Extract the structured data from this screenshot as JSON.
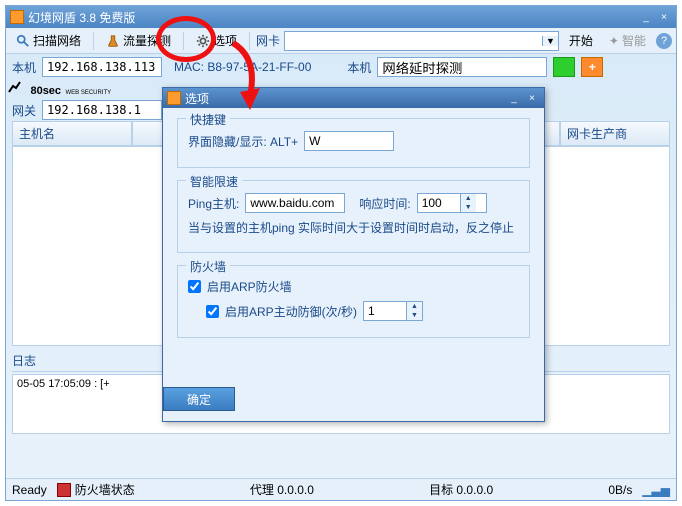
{
  "main": {
    "title": "幻境网盾 3.8 免费版",
    "toolbar": {
      "scan": "扫描网络",
      "traffic": "流量探测",
      "options": "选项",
      "netcard": "网卡",
      "start": "开始",
      "smart": "智能"
    },
    "row2": {
      "host_label": "本机",
      "host_ip": "192.168.138.113",
      "mac_label": "MAC: B8-97-5A-21-FF-00",
      "host2_label": "本机",
      "probe_value": "网络延时探测"
    },
    "row3": {
      "gateway_label": "网关",
      "gateway_ip": "192.168.138.1"
    },
    "logo": {
      "brand": "80sec",
      "sub": "WEB SECURITY"
    },
    "columns": {
      "hostname": "主机名",
      "vendor": "网卡生产商"
    },
    "log": {
      "title": "日志",
      "line": "05-05 17:05:09 : [+"
    },
    "status": {
      "ready": "Ready",
      "fw": "防火墙状态",
      "proxy": "代理 0.0.0.0",
      "target": "目标 0.0.0.0",
      "rate": "0B/s"
    }
  },
  "dialog": {
    "title": "选项",
    "hotkey": {
      "legend": "快捷键",
      "label": "界面隐藏/显示: ALT+",
      "value": "W"
    },
    "smart": {
      "legend": "智能限速",
      "ping_label": "Ping主机:",
      "ping_host": "www.baidu.com",
      "resp_label": "响应时间:",
      "resp_value": "100",
      "desc": "当与设置的主机ping 实际时间大于设置时间时启动，反之停止"
    },
    "firewall": {
      "legend": "防火墙",
      "enable_arp": "启用ARP防火墙",
      "enable_defense": "启用ARP主动防御(次/秒)",
      "defense_value": "1"
    },
    "ok": "确定"
  }
}
